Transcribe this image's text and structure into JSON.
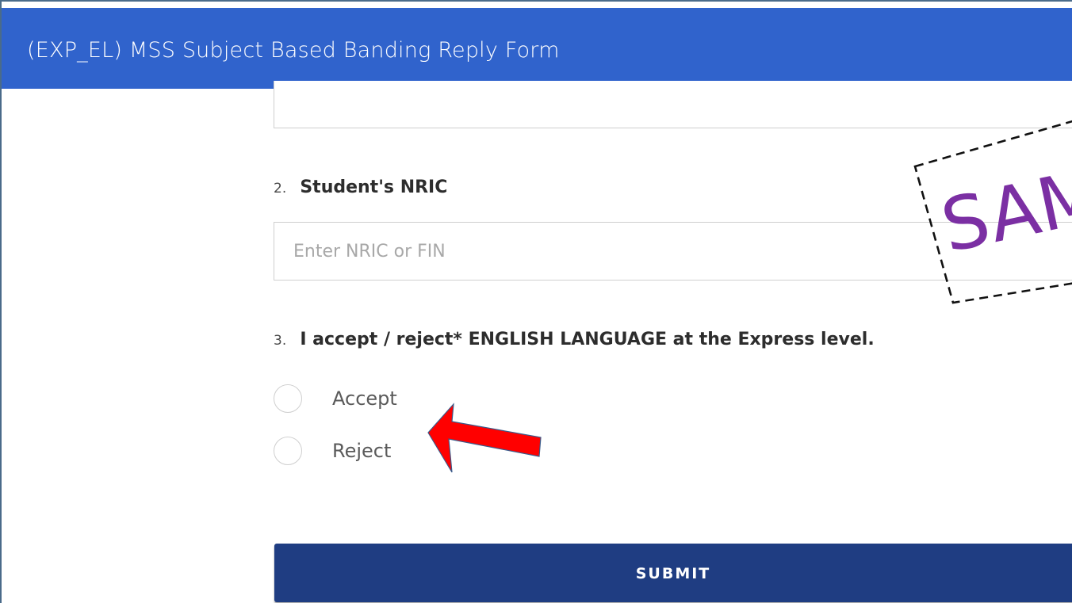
{
  "header": {
    "title": "(EXP_EL) MSS Subject Based Banding Reply Form",
    "background": "#3063cc"
  },
  "questions": [
    {
      "number": "2.",
      "label": "Student's NRIC",
      "input": {
        "placeholder": "Enter NRIC or FIN",
        "value": ""
      }
    },
    {
      "number": "3.",
      "label": "I accept / reject* ENGLISH LANGUAGE at the Express level.",
      "options": [
        "Accept",
        "Reject"
      ],
      "selected": null
    }
  ],
  "submit": {
    "label": "SUBMIT",
    "color": "#1f3d82"
  },
  "stamp": {
    "text": "SAM",
    "color": "#7b2fa3"
  },
  "annotation": {
    "arrow_color": "#ff0000",
    "arrow_icon": "red-arrow-icon"
  }
}
